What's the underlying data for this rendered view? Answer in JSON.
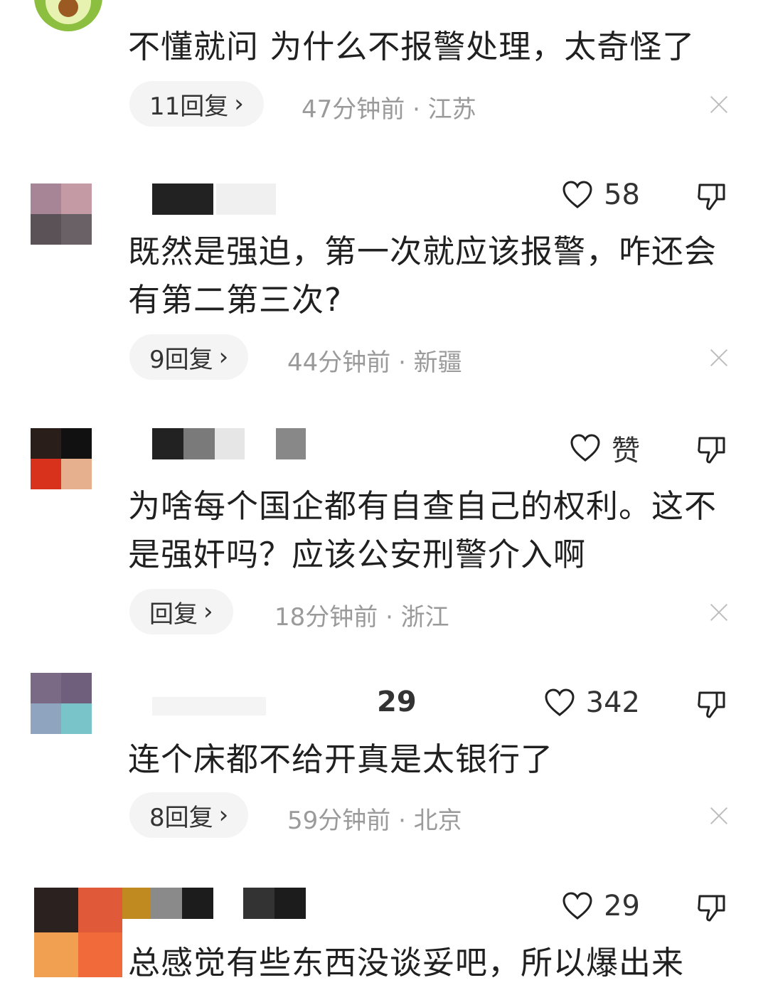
{
  "comments": [
    {
      "username": "",
      "likes": "",
      "text": "不懂就问 为什么不报警处理，太奇怪了",
      "reply_label": "11回复",
      "meta": "47分钟前 · 江苏"
    },
    {
      "username": "",
      "likes": "58",
      "text": "既然是强迫，第一次就应该报警，咋还会有第二第三次?",
      "reply_label": "9回复",
      "meta": "44分钟前 · 新疆"
    },
    {
      "username": "",
      "likes": "赞",
      "text": "为啥每个国企都有自查自己的权利。这不是强奸吗？应该公安刑警介入啊",
      "reply_label": "回复",
      "meta": "18分钟前 · 浙江"
    },
    {
      "username": "29",
      "likes": "342",
      "text": "连个床都不给开真是太银行了",
      "reply_label": "8回复",
      "meta": "59分钟前 · 北京"
    },
    {
      "username": "",
      "likes": "29",
      "text": "总感觉有些东西没谈妥吧，所以爆出来",
      "reply_label": "",
      "meta": ""
    }
  ],
  "icons": {
    "like": "heart-outline-icon",
    "dislike": "thumbs-down-icon",
    "close": "close-icon",
    "chevron": "chevron-right-icon"
  },
  "colors": {
    "text": "#202020",
    "meta": "#9a9a9a",
    "pill_bg": "#f4f4f4",
    "close": "#bdbdbd"
  }
}
